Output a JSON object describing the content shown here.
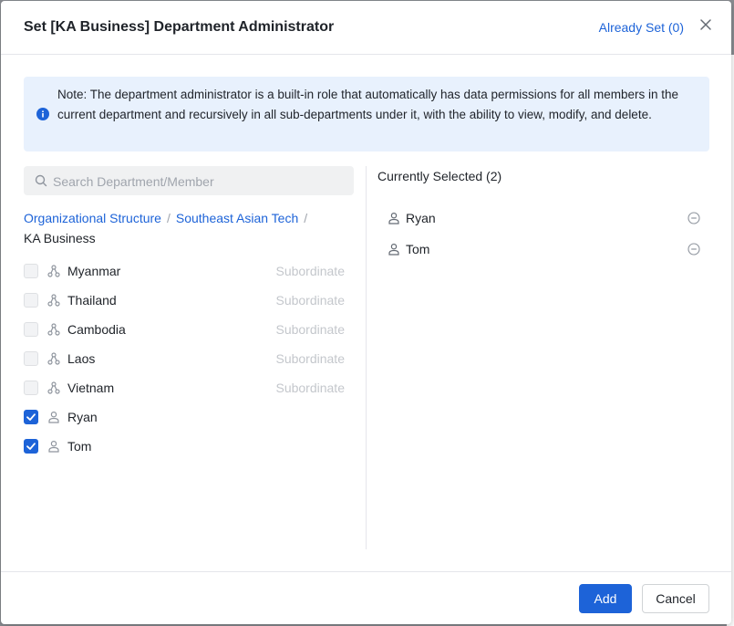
{
  "dialog": {
    "title": "Set [KA Business] Department Administrator",
    "already_set": "Already Set (0)"
  },
  "note": {
    "text": "Note: The department administrator is a built-in role that automatically has data permissions for all members in the current department and recursively in all sub-departments under it, with the ability to view, modify, and delete."
  },
  "search": {
    "placeholder": "Search Department/Member",
    "value": ""
  },
  "breadcrumb": {
    "links": [
      "Organizational Structure",
      "Southeast Asian Tech"
    ],
    "separator": "/",
    "current": "KA Business"
  },
  "list": {
    "subordinate_label": "Subordinate",
    "items": [
      {
        "label": "Myanmar",
        "type": "department",
        "checked": false
      },
      {
        "label": "Thailand",
        "type": "department",
        "checked": false
      },
      {
        "label": "Cambodia",
        "type": "department",
        "checked": false
      },
      {
        "label": "Laos",
        "type": "department",
        "checked": false
      },
      {
        "label": "Vietnam",
        "type": "department",
        "checked": false
      },
      {
        "label": "Ryan",
        "type": "member",
        "checked": true
      },
      {
        "label": "Tom",
        "type": "member",
        "checked": true
      }
    ]
  },
  "selected": {
    "title": "Currently Selected (2)",
    "items": [
      {
        "label": "Ryan"
      },
      {
        "label": "Tom"
      }
    ]
  },
  "footer": {
    "add_label": "Add",
    "cancel_label": "Cancel"
  },
  "colors": {
    "accent": "#1d63d8",
    "note_bg": "#e8f1fd",
    "muted": "#c4c7cc"
  },
  "icons": {
    "department": "org-tree-icon",
    "member": "person-icon",
    "remove": "minus-circle-icon",
    "close": "close-icon",
    "info": "info-icon",
    "search": "search-icon"
  }
}
